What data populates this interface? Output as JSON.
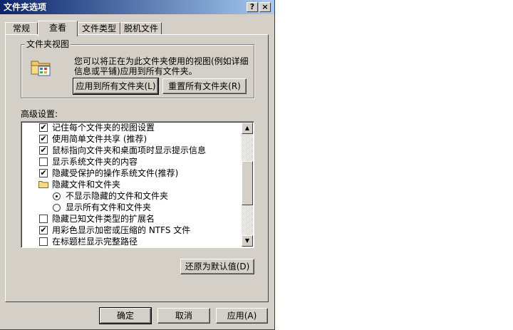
{
  "window": {
    "title": "文件夹选项",
    "help_btn": "?",
    "close_btn": "×"
  },
  "tabs": [
    {
      "label": "常规"
    },
    {
      "label": "查看"
    },
    {
      "label": "文件类型"
    },
    {
      "label": "脱机文件"
    }
  ],
  "folder_views": {
    "group_label": "文件夹视图",
    "description": "您可以将正在为此文件夹使用的视图(例如详细信息或平铺)应用到所有文件夹。",
    "apply_all_label": "应用到所有文件夹(L)",
    "reset_all_label": "重置所有文件夹(R)"
  },
  "advanced": {
    "label": "高级设置:",
    "items": [
      {
        "type": "checkbox",
        "checked": true,
        "label": "记住每个文件夹的视图设置"
      },
      {
        "type": "checkbox",
        "checked": true,
        "label": "使用简单文件共享 (推荐)"
      },
      {
        "type": "checkbox",
        "checked": true,
        "label": "鼠标指向文件夹和桌面项时显示提示信息"
      },
      {
        "type": "checkbox",
        "checked": false,
        "label": "显示系统文件夹的内容"
      },
      {
        "type": "checkbox",
        "checked": true,
        "label": "隐藏受保护的操作系统文件(推荐)"
      },
      {
        "type": "folder",
        "label": "隐藏文件和文件夹"
      },
      {
        "type": "radio",
        "checked": true,
        "label": "不显示隐藏的文件和文件夹"
      },
      {
        "type": "radio",
        "checked": false,
        "label": "显示所有文件和文件夹"
      },
      {
        "type": "checkbox",
        "checked": false,
        "label": "隐藏已知文件类型的扩展名"
      },
      {
        "type": "checkbox",
        "checked": true,
        "label": "用彩色显示加密或压缩的 NTFS 文件"
      },
      {
        "type": "checkbox",
        "checked": false,
        "label": "在标题栏显示完整路径"
      }
    ],
    "check_glyph": "✔",
    "scroll_up": "▲",
    "scroll_down": "▼"
  },
  "restore_defaults_label": "还原为默认值(D)",
  "footer": {
    "ok_label": "确定",
    "cancel_label": "取消",
    "apply_label": "应用(A)"
  }
}
